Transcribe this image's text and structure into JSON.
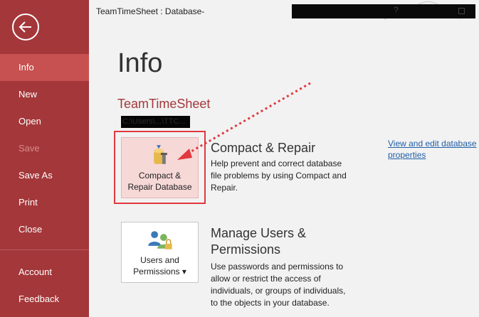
{
  "window": {
    "title": "TeamTimeSheet : Database-",
    "help_label": "?"
  },
  "sidebar": {
    "items": [
      {
        "label": "Info"
      },
      {
        "label": "New"
      },
      {
        "label": "Open"
      },
      {
        "label": "Save"
      },
      {
        "label": "Save As"
      },
      {
        "label": "Print"
      },
      {
        "label": "Close"
      },
      {
        "label": "Account"
      },
      {
        "label": "Feedback"
      }
    ]
  },
  "main": {
    "title": "Info",
    "database_name": "TeamTimeSheet",
    "database_path": "C:\\Users\\...\\TTC...",
    "compact": {
      "tile_line1": "Compact &",
      "tile_line2": "Repair Database",
      "heading": "Compact & Repair",
      "description": "Help prevent and correct database file problems by using Compact and Repair."
    },
    "users": {
      "tile_line1": "Users and",
      "tile_line2": "Permissions ▾",
      "heading": "Manage Users & Permissions",
      "description": "Use passwords and permissions to allow or restrict the access of individuals, or groups of individuals, to the objects in your database."
    },
    "properties_link": "View and edit database properties"
  },
  "colors": {
    "sidebar": "#a4373a",
    "sidebar_active": "#c75050",
    "accent": "#a4373a",
    "highlight": "#e0393e",
    "link": "#1f5fa8"
  }
}
